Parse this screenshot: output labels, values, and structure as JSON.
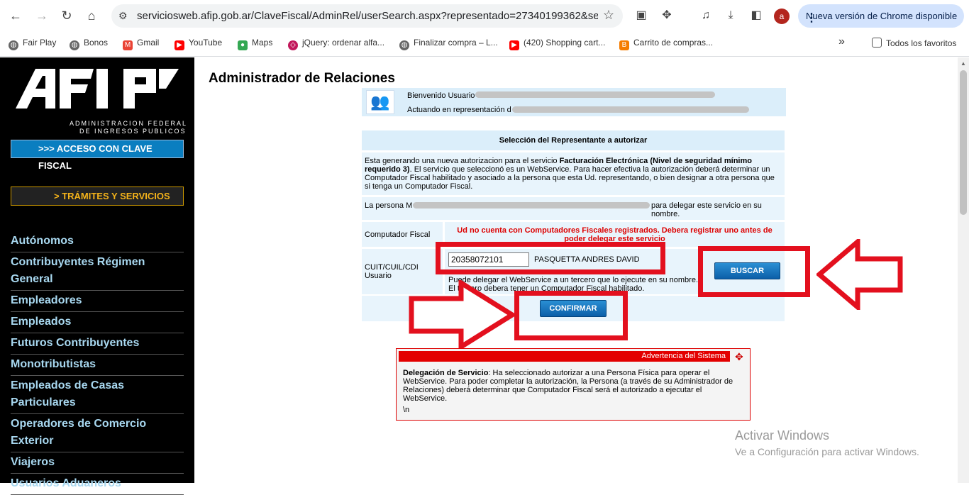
{
  "browser": {
    "url": "serviciosweb.afip.gob.ar/ClaveFiscal/AdminRel/userSearch.aspx?representado=27340199362&serviceN...",
    "avatar_letter": "a",
    "update_label": "Nueva versión de Chrome disponible",
    "bookmarks": [
      {
        "label": "Fair Play",
        "icon": "globe-icon"
      },
      {
        "label": "Bonos",
        "icon": "globe-icon"
      },
      {
        "label": "Gmail",
        "icon": "gmail-icon"
      },
      {
        "label": "YouTube",
        "icon": "youtube-icon"
      },
      {
        "label": "Maps",
        "icon": "maps-icon"
      },
      {
        "label": "jQuery: ordenar alfa...",
        "icon": "jquery-icon"
      },
      {
        "label": "Finalizar compra – L...",
        "icon": "globe-icon"
      },
      {
        "label": "(420) Shopping cart...",
        "icon": "youtube-icon"
      },
      {
        "label": "Carrito de compras...",
        "icon": "blogger-icon"
      }
    ],
    "all_bookmarks": "Todos los favoritos"
  },
  "sidebar": {
    "logo_line1": "ADMINISTRACION FEDERAL",
    "logo_line2": "DE INGRESOS PUBLICOS",
    "acceso_label": ">>> ACCESO CON CLAVE FISCAL",
    "tramites_label": ">    TRÁMITES Y SERVICIOS",
    "menu": [
      "Autónomos",
      "Contribuyentes Régimen General",
      "Empleadores",
      "Empleados",
      "Futuros Contribuyentes",
      "Monotributistas",
      "Empleados de Casas Particulares",
      "Operadores de Comercio Exterior",
      "Viajeros",
      "Usuarios Aduaneros"
    ]
  },
  "main": {
    "title": "Administrador de Relaciones",
    "welcome_user": "Bienvenido Usuario",
    "welcome_rep": "Actuando en representación d",
    "form_header": "Selección del Representante a autorizar",
    "desc_pre": "Esta generando una nueva autorizacion para el servicio ",
    "desc_bold": "Facturación Electrónica (Nivel de seguridad mínimo requerido 3)",
    "desc_post": ". El servicio que seleccionó es un WebService. Para hacer efectiva la autorización deberá determinar un Computador Fiscal habilitado y asociado a la persona que esta Ud. representando, o bien designar a otra persona que si tenga un Computador Fiscal.",
    "persona_pre": "La persona M",
    "persona_post": "para delegar este servicio en su nombre.",
    "computador_label": "Computador Fiscal",
    "computador_error": "Ud no cuenta con Computadores Fiscales registrados. Debera registrar uno antes de poder delegar este servicio",
    "cuit_label": "CUIT/CUIL/CDI Usuario",
    "cuit_value": "20358072101",
    "cuit_name": "PASQUETTA ANDRES DAVID",
    "cuit_help1": "Puede delegar el WebService a un tercero que lo ejecute en su nombre.",
    "cuit_help2": "El tercero debera tener un Computador Fiscal habilitado.",
    "buscar_label": "BUSCAR",
    "confirmar_label": "CONFIRMAR"
  },
  "warning": {
    "header": "Advertencia del Sistema",
    "bold": "Delegación de Servicio",
    "text": ": Ha seleccionado autorizar a una Persona Física para operar el WebService. Para poder completar la autorización, la Persona (a través de su Administrador de Relaciones) deberá determinar que Computador Fiscal será el autorizado a ejecutar el WebService.",
    "footer": "\\n"
  },
  "watermark": {
    "line1": "Activar Windows",
    "line2": "Ve a Configuración para activar Windows."
  },
  "colors": {
    "accent_red": "#e3101e",
    "sidebar_bg": "#000000",
    "button_blue": "#0c5fa8",
    "panel_blue": "#dbeefa"
  }
}
